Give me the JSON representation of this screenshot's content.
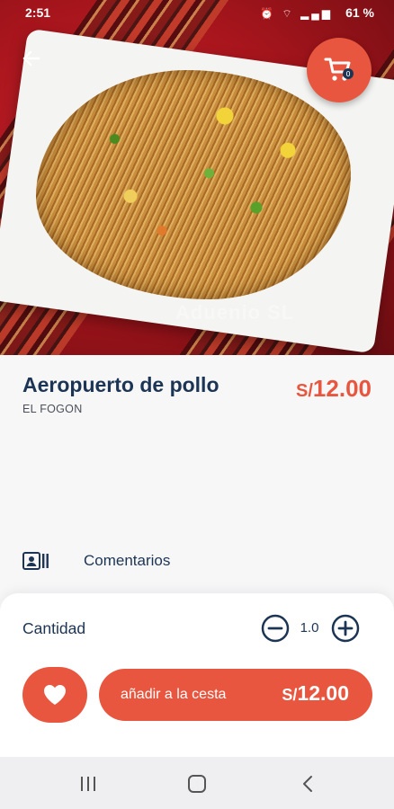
{
  "status_bar": {
    "time": "2:51",
    "battery": "61 %"
  },
  "hero": {
    "watermark": "Aduenio SL"
  },
  "header": {
    "back_icon": "arrow-left-icon",
    "cart_icon": "cart-icon",
    "cart_badge": "0"
  },
  "product": {
    "name": "Aeropuerto de pollo",
    "restaurant": "EL FOGON",
    "currency": "S/",
    "price": "12.00"
  },
  "tabs": {
    "info_icon": "contact-card-icon",
    "comments_label": "Comentarios"
  },
  "order": {
    "quantity_label": "Cantidad",
    "quantity_value": "1.0",
    "minus_icon": "minus-circle-icon",
    "plus_icon": "plus-circle-icon",
    "favorite_icon": "heart-icon",
    "add_label": "añadir a la cesta",
    "currency": "S/",
    "total": "12.00"
  },
  "navbar": {
    "recents_icon": "recents-icon",
    "home_icon": "home-icon",
    "back_icon": "back-icon"
  },
  "colors": {
    "accent": "#e8563f",
    "primary_text": "#1d3554",
    "background": "#f7f7f8"
  }
}
